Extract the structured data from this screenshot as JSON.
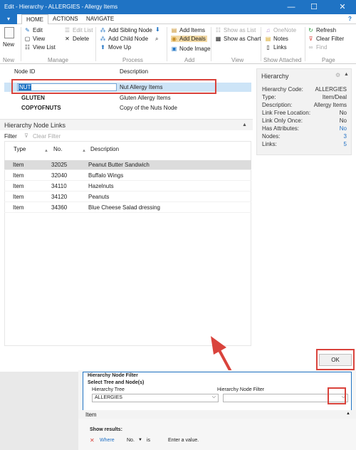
{
  "window": {
    "title": "Edit - Hierarchy - ALLERGIES - Allergy Items",
    "minimize": "—",
    "maximize": "☐",
    "close": "✕"
  },
  "ribbon": {
    "file_tab": "▾",
    "tabs": [
      "HOME",
      "ACTIONS",
      "NAVIGATE"
    ],
    "help": "?",
    "new": "New",
    "edit": "Edit",
    "view": "View",
    "view_list": "View List",
    "edit_list": "Edit List",
    "delete": "Delete",
    "add_sibling_node": "Add Sibling Node",
    "add_child_node": "Add Child Node",
    "move_up": "Move Up",
    "add_items": "Add Items",
    "add_deals": "Add Deals",
    "node_image": "Node Image",
    "show_as_list": "Show as List",
    "show_as_chart": "Show as Chart",
    "onenote": "OneNote",
    "notes": "Notes",
    "links": "Links",
    "refresh": "Refresh",
    "clear_filter": "Clear Filter",
    "find": "Find",
    "groups": [
      "New",
      "Manage",
      "Process",
      "Add",
      "View",
      "Show Attached",
      "Page"
    ]
  },
  "nodes": {
    "col_node_id": "Node ID",
    "col_description": "Description",
    "rows": [
      {
        "id": "NUT",
        "description": "Nut Allergy Items"
      },
      {
        "id": "GLUTEN",
        "description": "Gluten Allergy Items"
      },
      {
        "id": "COPYOFNUTS",
        "description": "Copy of the Nuts Node"
      }
    ]
  },
  "factbox": {
    "title": "Hierarchy",
    "fields": [
      {
        "label": "Hierarchy Code:",
        "value": "ALLERGIES"
      },
      {
        "label": "Type:",
        "value": "Item/Deal"
      },
      {
        "label": "Description:",
        "value": "Allergy Items"
      },
      {
        "label": "Link Free Location:",
        "value": "No"
      },
      {
        "label": "Link Only Once:",
        "value": "No"
      },
      {
        "label": "Has Attributes:",
        "value": "No"
      },
      {
        "label": "Nodes:",
        "value": "3"
      },
      {
        "label": "Links:",
        "value": "5"
      }
    ]
  },
  "links": {
    "title": "Hierarchy Node Links",
    "filter_label": "Filter",
    "clear_filter": "Clear Filter",
    "col_type": "Type",
    "col_no": "No.",
    "col_description": "Description",
    "rows": [
      {
        "type": "Item",
        "no": "32025",
        "description": "Peanut Butter Sandwich"
      },
      {
        "type": "Item",
        "no": "32040",
        "description": "Buffalo Wings"
      },
      {
        "type": "Item",
        "no": "34110",
        "description": "Hazelnuts"
      },
      {
        "type": "Item",
        "no": "34120",
        "description": "Peanuts"
      },
      {
        "type": "Item",
        "no": "34360",
        "description": "Blue Cheese Salad dressing"
      }
    ]
  },
  "ok_button": "OK",
  "background_page": {
    "filter_title": "Hierarchy Node Filter",
    "select_title": "Select Tree and Node(s)",
    "tree_label": "Hierarchy Tree",
    "tree_value": "ALLERGIES",
    "node_filter_label": "Hierarchy Node Filter",
    "item_section": "Item",
    "show_results": "Show results:",
    "where": "Where",
    "field": "No.",
    "op": "is",
    "value_placeholder": "Enter a value."
  },
  "colors": {
    "accent": "#1f73c4",
    "highlight": "#d9433c",
    "selected_row": "#cde4f7"
  }
}
